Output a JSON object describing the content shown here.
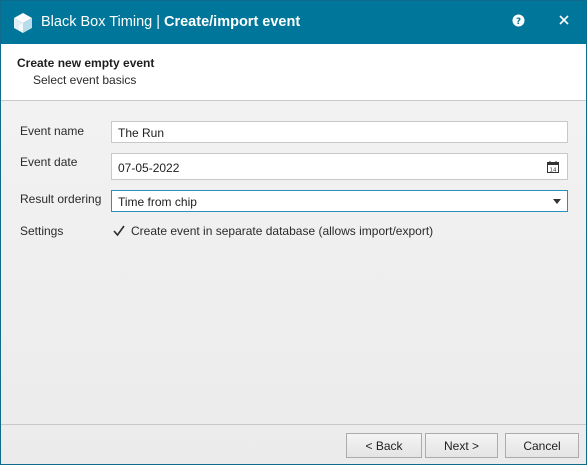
{
  "window": {
    "app_name": "Black Box Timing",
    "separator": "|",
    "dialog_title": "Create/import event",
    "help_icon": "help-icon",
    "close_icon": "close-icon",
    "accent_color": "#00779a"
  },
  "header": {
    "title": "Create new empty event",
    "subtitle": "Select event basics"
  },
  "form": {
    "event_name_label": "Event name",
    "event_name_value": "The Run",
    "event_date_label": "Event date",
    "event_date_value": "07-05-2022",
    "result_ordering_label": "Result ordering",
    "result_ordering_value": "Time from chip",
    "settings_label": "Settings",
    "separate_db_label": "Create event in separate database (allows import/export)",
    "separate_db_checked": true
  },
  "footer": {
    "back_label": "< Back",
    "next_label": "Next >",
    "cancel_label": "Cancel"
  }
}
